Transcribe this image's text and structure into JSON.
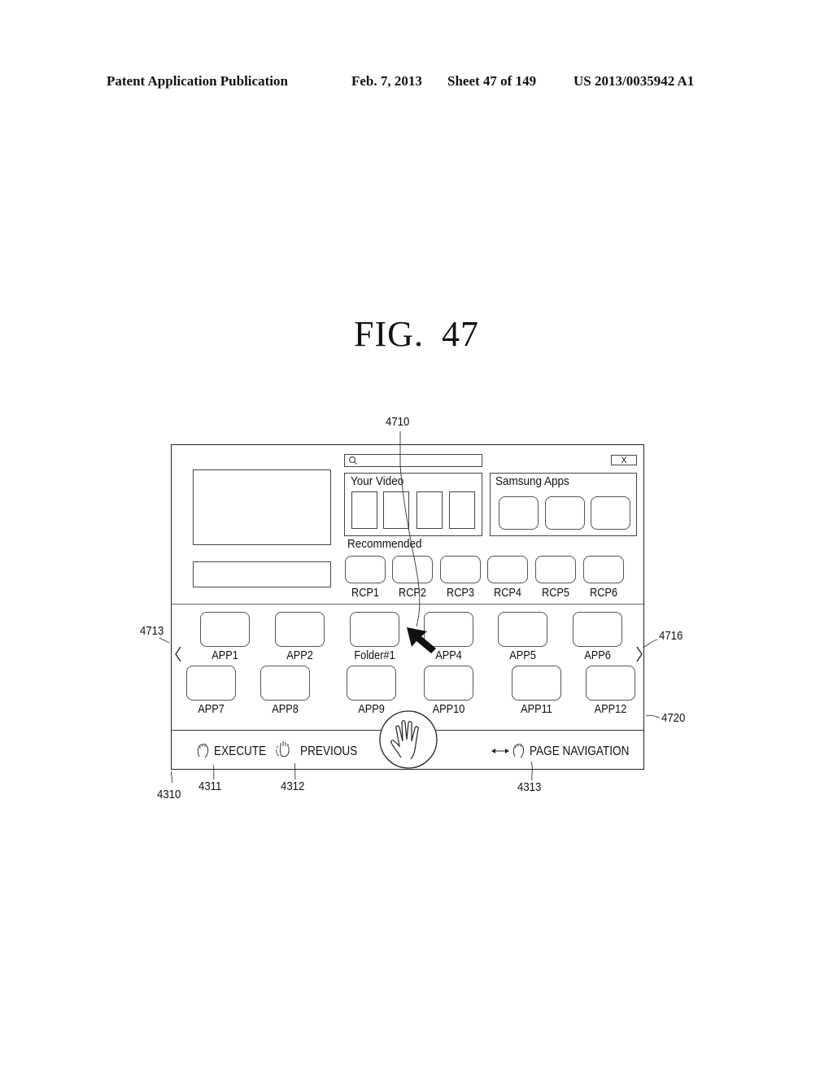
{
  "header": {
    "publication": "Patent Application Publication",
    "date": "Feb. 7, 2013",
    "sheet": "Sheet 47 of 149",
    "number": "US 2013/0035942 A1"
  },
  "figure": {
    "prefix": "FIG.",
    "number": "47"
  },
  "ui": {
    "search": {
      "icon": "search-icon",
      "value": ""
    },
    "close": {
      "icon": "close-icon",
      "label": "X"
    },
    "your_video": {
      "title": "Your Video",
      "thumbnails": 4
    },
    "samsung_apps": {
      "title": "Samsung Apps",
      "tiles": 3
    },
    "recommended": {
      "title": "Recommended",
      "items": [
        "RCP1",
        "RCP2",
        "RCP3",
        "RCP4",
        "RCP5",
        "RCP6"
      ]
    },
    "apps_row1": [
      "APP1",
      "APP2",
      "Folder#1",
      "APP4",
      "APP5",
      "APP6"
    ],
    "apps_row2": [
      "APP7",
      "APP8",
      "APP9",
      "APP10",
      "APP11",
      "APP12"
    ],
    "nav": {
      "left": "chevron-left-icon",
      "right": "chevron-right-icon"
    },
    "guide_bar": {
      "execute": "EXECUTE",
      "previous": "PREVIOUS",
      "page_navigation": "PAGE NAVIGATION",
      "center_icon": "open-hand-icon"
    }
  },
  "references": {
    "r4710": "4710",
    "r4713": "4713",
    "r4716": "4716",
    "r4720": "4720",
    "r4310": "4310",
    "r4311": "4311",
    "r4312": "4312",
    "r4313": "4313"
  }
}
